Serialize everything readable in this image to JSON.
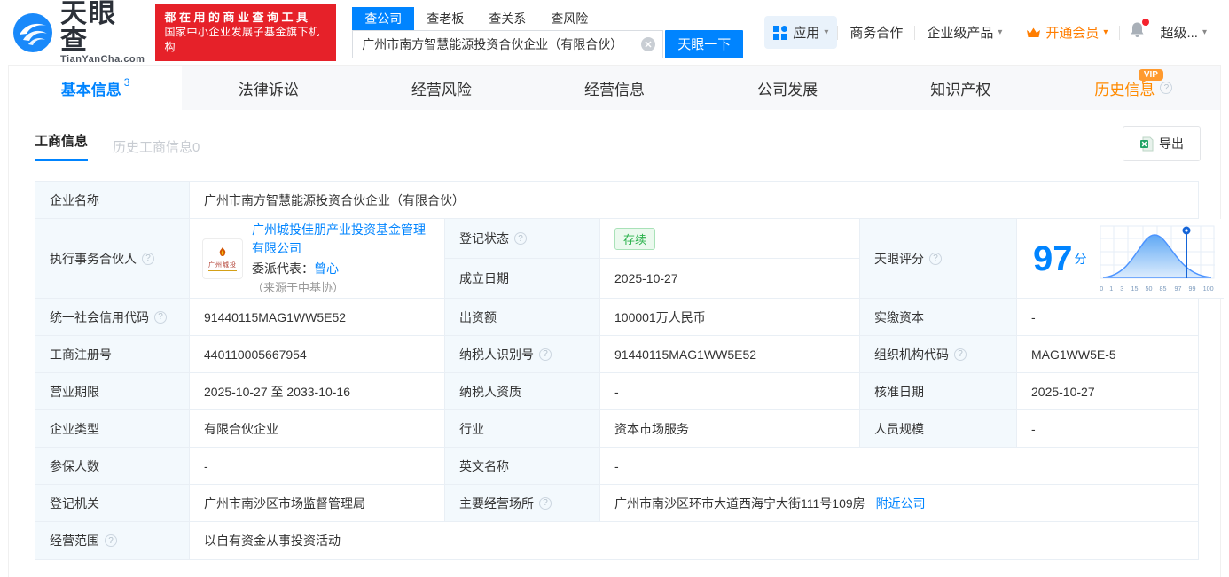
{
  "brand": {
    "logo_title": "天眼查",
    "logo_subtitle": "TianYanCha.com",
    "promo_line1": "都在用的商业查询工具",
    "promo_line2": "国家中小企业发展子基金旗下机构",
    "accent_color": "#0084ff",
    "promo_color": "#e62129"
  },
  "icons": {
    "help": "?",
    "caret": "▾"
  },
  "search": {
    "tabs": [
      {
        "label": "查公司",
        "active": true
      },
      {
        "label": "查老板",
        "active": false
      },
      {
        "label": "查关系",
        "active": false
      },
      {
        "label": "查风险",
        "active": false
      }
    ],
    "value": "广州市南方智慧能源投资合伙企业（有限合伙）",
    "button": "天眼一下"
  },
  "header_menu": {
    "apps": "应用",
    "business_cooperation": "商务合作",
    "enterprise_products": "企业级产品",
    "vip": "开通会员",
    "user": "超级..."
  },
  "nav_tabs": [
    {
      "label": "基本信息",
      "badge": "3",
      "active": true
    },
    {
      "label": "法律诉讼"
    },
    {
      "label": "经营风险"
    },
    {
      "label": "经营信息"
    },
    {
      "label": "公司发展"
    },
    {
      "label": "知识产权"
    },
    {
      "label": "历史信息",
      "vip": "VIP"
    }
  ],
  "subtabs": {
    "active": "工商信息",
    "inactive": "历史工商信息0"
  },
  "export_label": "导出",
  "info": {
    "company_name_label": "企业名称",
    "company_name": "广州市南方智慧能源投资合伙企业（有限合伙）",
    "partner_label": "执行事务合伙人",
    "partner_name": "广州城投佳朋产业投资基金管理有限公司",
    "partner_logo_text": "广州城投",
    "rep_label": "委派代表：",
    "rep_name": "曾心",
    "rep_source": "（来源于中基协）",
    "reg_status_label": "登记状态",
    "reg_status": "存续",
    "est_date_label": "成立日期",
    "est_date": "2025-10-27",
    "score_label": "天眼评分",
    "score": "97",
    "score_unit": "分",
    "uscc_label": "统一社会信用代码",
    "uscc": "91440115MAG1WW5E52",
    "capital_label": "出资额",
    "capital": "100001万人民币",
    "paid_capital_label": "实缴资本",
    "paid_capital": "-",
    "reg_no_label": "工商注册号",
    "reg_no": "440110005667954",
    "tax_id_label": "纳税人识别号",
    "tax_id": "91440115MAG1WW5E52",
    "org_code_label": "组织机构代码",
    "org_code": "MAG1WW5E-5",
    "term_label": "营业期限",
    "term": "2025-10-27 至 2033-10-16",
    "tax_quality_label": "纳税人资质",
    "tax_quality": "-",
    "approval_date_label": "核准日期",
    "approval_date": "2025-10-27",
    "company_type_label": "企业类型",
    "company_type": "有限合伙企业",
    "industry_label": "行业",
    "industry": "资本市场服务",
    "staff_size_label": "人员规模",
    "staff_size": "-",
    "insured_label": "参保人数",
    "insured": "-",
    "en_name_label": "英文名称",
    "en_name": "-",
    "authority_label": "登记机关",
    "authority": "广州市南沙区市场监督管理局",
    "address_label": "主要经营场所",
    "address": "广州市南沙区环市大道西海宁大街111号109房",
    "nearby_link": "附近公司",
    "scope_label": "经营范围",
    "scope": "以自有资金从事投资活动"
  },
  "score_chart": {
    "type": "area",
    "ticks": [
      "0",
      "1",
      "3",
      "15",
      "50",
      "85",
      "97",
      "99",
      "100"
    ],
    "marker_value": "97"
  }
}
